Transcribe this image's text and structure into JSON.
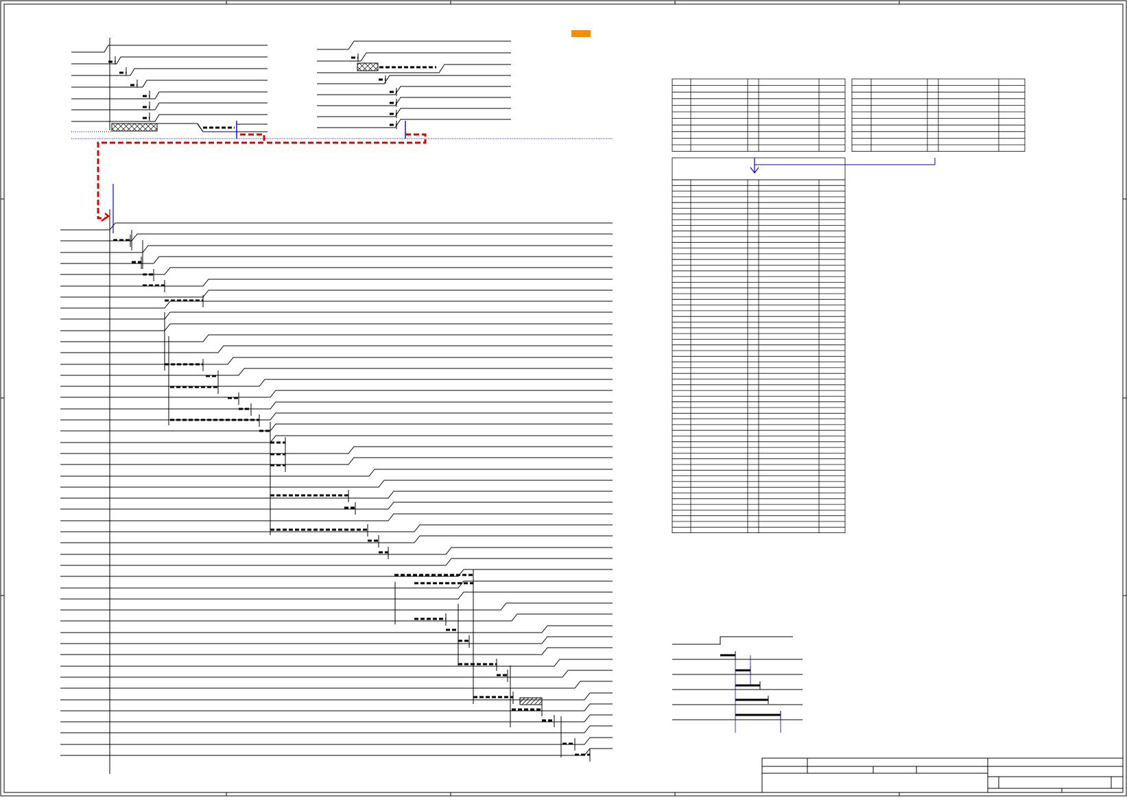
{
  "sheet": {
    "frame_color": "#000000",
    "accent_marker_color": "#ff8c00",
    "flow_arrow_color": "#e00000",
    "reference_line_color": "#0000cc"
  },
  "title_block": {
    "drawing_no": "",
    "revision": ""
  }
}
